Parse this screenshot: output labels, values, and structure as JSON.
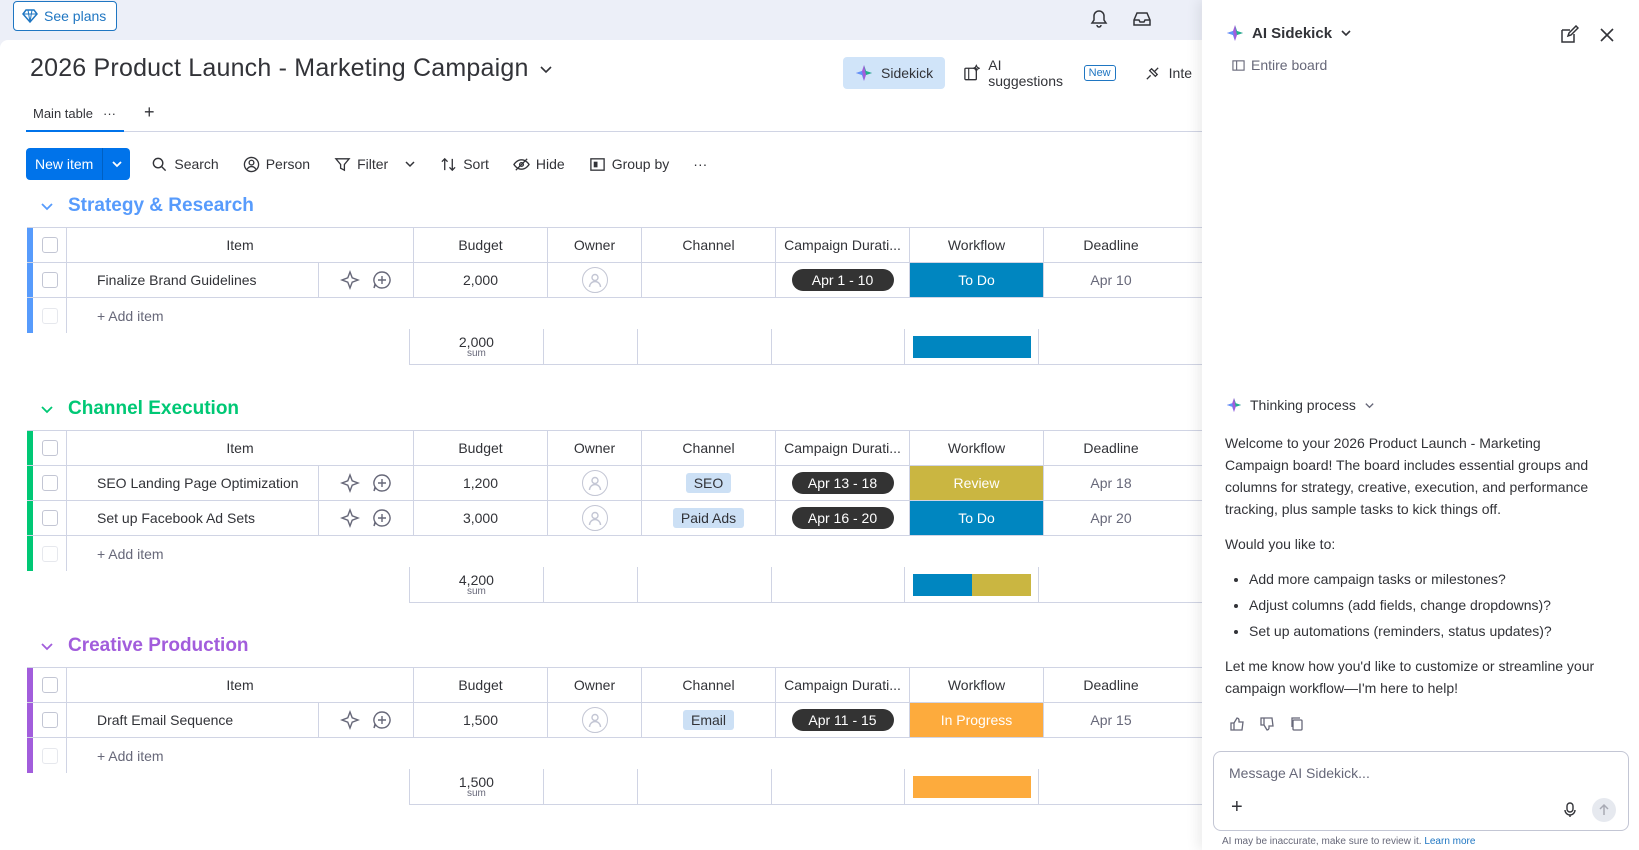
{
  "topbar": {
    "see_plans": "See plans"
  },
  "board": {
    "title": "2026 Product Launch - Marketing Campaign",
    "sidekick_label": "Sidekick",
    "ai_suggestions_label": "AI suggestions",
    "new_badge": "New",
    "integrate_label": "Inte",
    "tab_main": "Main table",
    "tab_more": "···",
    "tab_add": "+"
  },
  "toolbar": {
    "new_item": "New item",
    "search": "Search",
    "person": "Person",
    "filter": "Filter",
    "sort": "Sort",
    "hide": "Hide",
    "group_by": "Group by",
    "more": "···"
  },
  "columns": {
    "item": "Item",
    "budget": "Budget",
    "owner": "Owner",
    "channel": "Channel",
    "duration": "Campaign Durati...",
    "workflow": "Workflow",
    "deadline": "Deadline"
  },
  "add_item": "+ Add item",
  "sum_label": "sum",
  "colors": {
    "todo": "#0086c0",
    "review": "#cab641",
    "in_progress": "#fdab3d",
    "group1": "#579bfc",
    "group2": "#00c875",
    "group3": "#a25ddc"
  },
  "groups": [
    {
      "title": "Strategy & Research",
      "rows": [
        {
          "item": "Finalize Brand Guidelines",
          "budget": "2,000",
          "channel": "",
          "duration": "Apr 1 - 10",
          "workflow": "To Do",
          "deadline": "Apr 10"
        }
      ],
      "sum": "2,000"
    },
    {
      "title": "Channel Execution",
      "rows": [
        {
          "item": "SEO Landing Page Optimization",
          "budget": "1,200",
          "channel": "SEO",
          "duration": "Apr 13 - 18",
          "workflow": "Review",
          "deadline": "Apr 18"
        },
        {
          "item": "Set up Facebook Ad Sets",
          "budget": "3,000",
          "channel": "Paid Ads",
          "duration": "Apr 16 - 20",
          "workflow": "To Do",
          "deadline": "Apr 20"
        }
      ],
      "sum": "4,200"
    },
    {
      "title": "Creative Production",
      "rows": [
        {
          "item": "Draft Email Sequence",
          "budget": "1,500",
          "channel": "Email",
          "duration": "Apr 11 - 15",
          "workflow": "In Progress",
          "deadline": "Apr 15"
        }
      ],
      "sum": "1,500"
    }
  ],
  "panel": {
    "title": "AI Sidekick",
    "scope": "Entire board",
    "thinking": "Thinking process",
    "message_p1": "Welcome to your 2026 Product Launch - Marketing Campaign board! The board includes essential groups and columns for strategy, creative, execution, and performance tracking, plus sample tasks to kick things off.",
    "message_p2": "Would you like to:",
    "bullets": [
      "Add more campaign tasks or milestones?",
      "Adjust columns (add fields, change dropdowns)?",
      "Set up automations (reminders, status updates)?"
    ],
    "message_p3": "Let me know how you'd like to customize or streamline your campaign workflow—I'm here to help!",
    "input_placeholder": "Message AI Sidekick...",
    "disclaimer": "AI may be inaccurate, make sure to review it.",
    "learn_more": "Learn more"
  }
}
